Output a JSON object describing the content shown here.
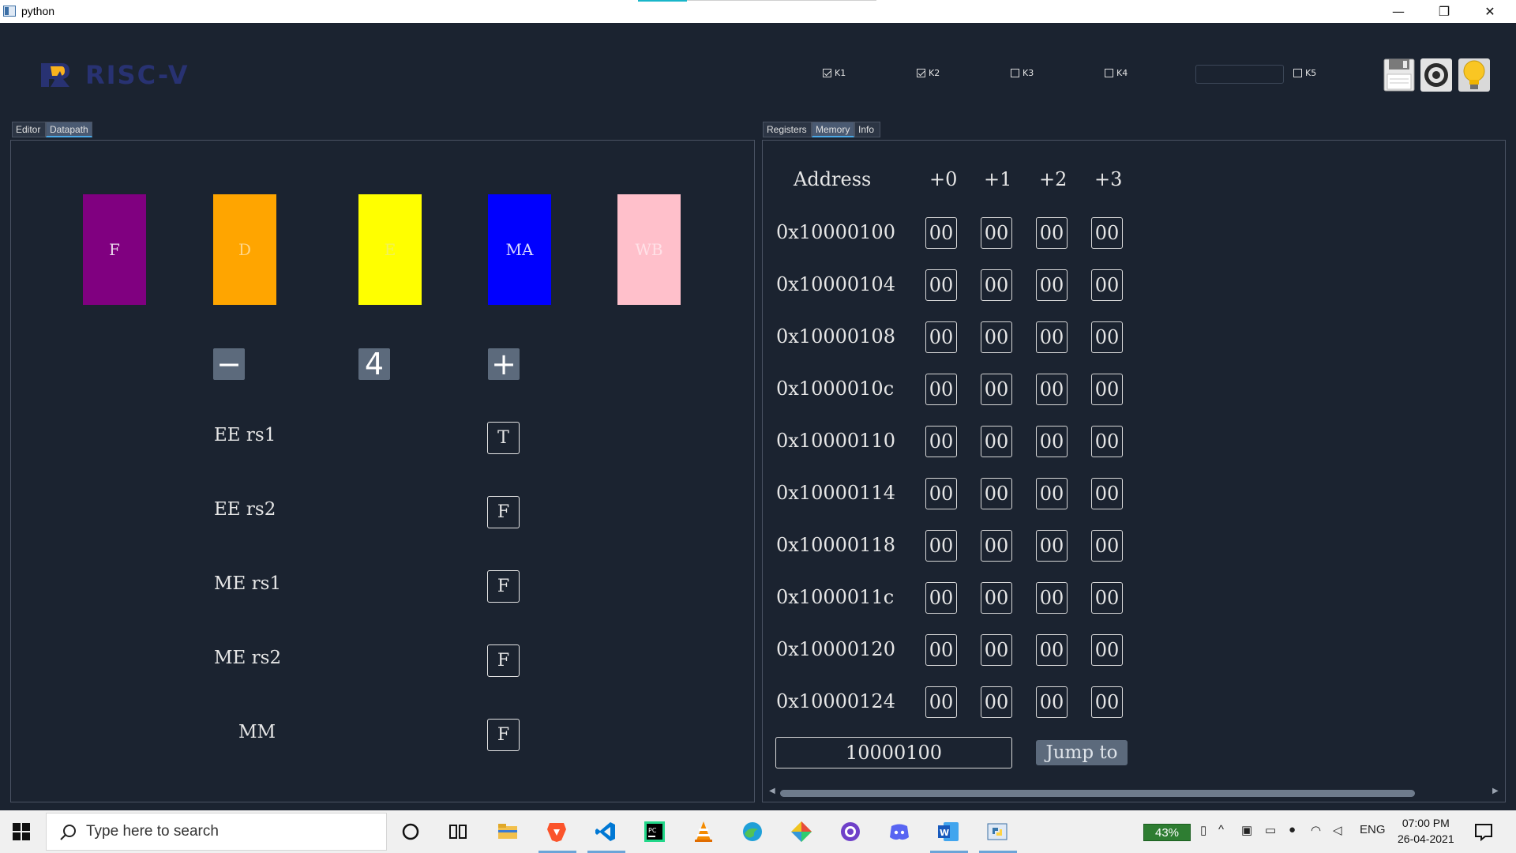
{
  "window": {
    "title": "python",
    "minimize": "—",
    "maximize": "❐",
    "close": "✕"
  },
  "header": {
    "logo_text": "RISC-V",
    "knobs": [
      {
        "label": "K1",
        "checked": true
      },
      {
        "label": "K2",
        "checked": true
      },
      {
        "label": "K3",
        "checked": false
      },
      {
        "label": "K4",
        "checked": false
      },
      {
        "label": "K5",
        "checked": false
      }
    ],
    "k_input_value": "",
    "tools": [
      "save-icon",
      "settings-icon",
      "lightbulb-icon"
    ]
  },
  "left_tabs": [
    "Editor",
    "Datapath"
  ],
  "left_active_tab": "Datapath",
  "right_tabs": [
    "Registers",
    "Memory",
    "Info"
  ],
  "right_active_tab": "Memory",
  "datapath": {
    "stages": [
      {
        "label": "F",
        "color": "#800080",
        "text_color": "#e8d7ea"
      },
      {
        "label": "D",
        "color": "#ffa500",
        "text_color": "#ffd68a"
      },
      {
        "label": "E",
        "color": "#ffff00",
        "text_color": "#f1f15a"
      },
      {
        "label": "MA",
        "color": "#0000ff",
        "text_color": "#d9d9ff"
      },
      {
        "label": "WB",
        "color": "#ffc0cb",
        "text_color": "#ffe1e7"
      }
    ],
    "decrement": "−",
    "counter": "4",
    "increment": "+",
    "signals": [
      {
        "label": "EE  rs1",
        "value": "T"
      },
      {
        "label": "EE  rs2",
        "value": "F"
      },
      {
        "label": "ME  rs1",
        "value": "F"
      },
      {
        "label": "ME  rs2",
        "value": "F"
      },
      {
        "label": "MM",
        "value": "F"
      }
    ]
  },
  "memory": {
    "headers": [
      "Address",
      "+0",
      "+1",
      "+2",
      "+3"
    ],
    "rows": [
      {
        "address": "0x10000100",
        "bytes": [
          "00",
          "00",
          "00",
          "00"
        ]
      },
      {
        "address": "0x10000104",
        "bytes": [
          "00",
          "00",
          "00",
          "00"
        ]
      },
      {
        "address": "0x10000108",
        "bytes": [
          "00",
          "00",
          "00",
          "00"
        ]
      },
      {
        "address": "0x1000010c",
        "bytes": [
          "00",
          "00",
          "00",
          "00"
        ]
      },
      {
        "address": "0x10000110",
        "bytes": [
          "00",
          "00",
          "00",
          "00"
        ]
      },
      {
        "address": "0x10000114",
        "bytes": [
          "00",
          "00",
          "00",
          "00"
        ]
      },
      {
        "address": "0x10000118",
        "bytes": [
          "00",
          "00",
          "00",
          "00"
        ]
      },
      {
        "address": "0x1000011c",
        "bytes": [
          "00",
          "00",
          "00",
          "00"
        ]
      },
      {
        "address": "0x10000120",
        "bytes": [
          "00",
          "00",
          "00",
          "00"
        ]
      },
      {
        "address": "0x10000124",
        "bytes": [
          "00",
          "00",
          "00",
          "00"
        ]
      }
    ],
    "jump_value": "10000100",
    "jump_label": "Jump to"
  },
  "taskbar": {
    "search_placeholder": "Type here to search",
    "battery": "43%",
    "language": "ENG",
    "time": "07:00 PM",
    "date": "26-04-2021"
  }
}
